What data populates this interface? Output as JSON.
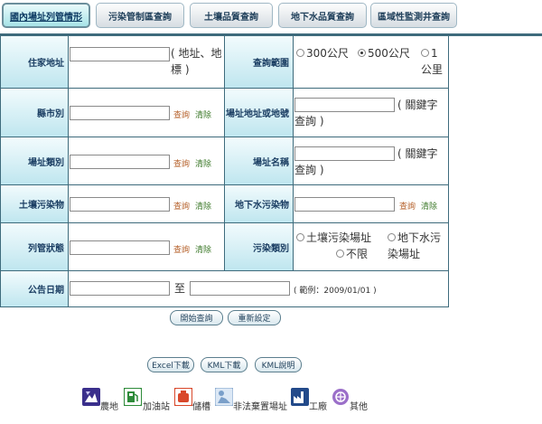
{
  "tabs": [
    {
      "label": "國內場址列管情形",
      "active": true
    },
    {
      "label": "污染管制區查詢",
      "active": false
    },
    {
      "label": "土壤品質查詢",
      "active": false
    },
    {
      "label": "地下水品質查詢",
      "active": false
    },
    {
      "label": "區域性監測井查詢",
      "active": false
    }
  ],
  "form": {
    "home_address": {
      "label": "住家地址",
      "value": "",
      "hint": "( 地址、地標 )"
    },
    "search_range": {
      "label": "查詢範圍",
      "options": [
        "300公尺",
        "500公尺",
        "1公里"
      ],
      "selected": "500公尺"
    },
    "county": {
      "label": "縣市別",
      "value": ""
    },
    "site_address": {
      "label": "場址地址或地號",
      "value": "",
      "hint": "( 關鍵字查詢 )"
    },
    "site_category": {
      "label": "場址類別",
      "value": ""
    },
    "site_name": {
      "label": "場址名稱",
      "value": "",
      "hint": "( 關鍵字查詢 )"
    },
    "soil_pollutant": {
      "label": "土壤污染物",
      "value": ""
    },
    "groundwater_pollutant": {
      "label": "地下水污染物",
      "value": ""
    },
    "control_status": {
      "label": "列管狀態",
      "value": ""
    },
    "pollution_type": {
      "label": "污染類別",
      "options": [
        "土壤污染場址",
        "地下水污染場址",
        "不限"
      ],
      "selected": ""
    },
    "announce_date": {
      "label": "公告日期",
      "from": "",
      "to_label": "至",
      "to": "",
      "example": "( 範例：2009/01/01 )"
    }
  },
  "links": {
    "query": "查詢",
    "clear": "清除"
  },
  "actions": {
    "start_query": "開始查詢",
    "reset": "重新設定"
  },
  "downloads": {
    "excel": "Excel下載",
    "kml": "KML下載",
    "kml_help": "KML說明"
  },
  "legend": [
    {
      "label": "農地",
      "icon": "farmland-icon",
      "color": "#3a2f8c"
    },
    {
      "label": "加油站",
      "icon": "gas-station-icon",
      "color": "#2e8b3a"
    },
    {
      "label": "儲槽",
      "icon": "storage-tank-icon",
      "color": "#d9482b"
    },
    {
      "label": "非法棄置場址",
      "icon": "illegal-dumping-icon",
      "color": "#7a9fc9"
    },
    {
      "label": "工廠",
      "icon": "factory-icon",
      "color": "#234a8a"
    },
    {
      "label": "其他",
      "icon": "other-icon",
      "color": "#9b6fc9"
    }
  ]
}
